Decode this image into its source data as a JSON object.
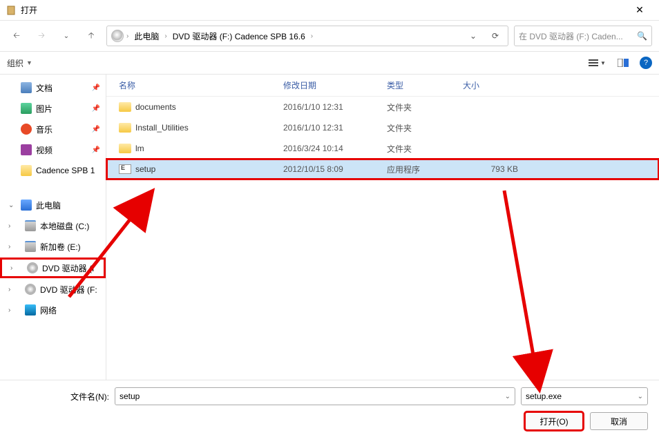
{
  "window": {
    "title": "打开"
  },
  "breadcrumb": {
    "root": "此电脑",
    "drive": "DVD 驱动器 (F:) Cadence SPB 16.6"
  },
  "search": {
    "placeholder": "在 DVD 驱动器 (F:) Caden..."
  },
  "toolbar": {
    "organize": "组织"
  },
  "sidebar": {
    "quick": [
      {
        "label": "文档",
        "icon": "qi-doc"
      },
      {
        "label": "图片",
        "icon": "qi-pic"
      },
      {
        "label": "音乐",
        "icon": "qi-music"
      },
      {
        "label": "视频",
        "icon": "qi-video"
      },
      {
        "label": "Cadence SPB 1",
        "icon": "qi-folder"
      }
    ],
    "thispc": {
      "label": "此电脑"
    },
    "drives": [
      {
        "label": "本地磁盘 (C:)",
        "icon": "qi-drive"
      },
      {
        "label": "新加卷 (E:)",
        "icon": "qi-drive"
      },
      {
        "label": "DVD 驱动器 (I",
        "icon": "qi-disc",
        "highlight": true
      },
      {
        "label": "DVD 驱动器 (F:",
        "icon": "qi-disc"
      },
      {
        "label": "网络",
        "icon": "qi-net"
      }
    ]
  },
  "columns": {
    "name": "名称",
    "date": "修改日期",
    "type": "类型",
    "size": "大小"
  },
  "files": [
    {
      "name": "documents",
      "date": "2016/1/10 12:31",
      "type": "文件夹",
      "size": "",
      "icon": "folder-icon"
    },
    {
      "name": "Install_Utilities",
      "date": "2016/1/10 12:31",
      "type": "文件夹",
      "size": "",
      "icon": "folder-icon"
    },
    {
      "name": "lm",
      "date": "2016/3/24 10:14",
      "type": "文件夹",
      "size": "",
      "icon": "folder-icon"
    },
    {
      "name": "setup",
      "date": "2012/10/15 8:09",
      "type": "应用程序",
      "size": "793 KB",
      "icon": "exe-icon",
      "selected": true
    }
  ],
  "footer": {
    "filename_label": "文件名(N):",
    "filename_value": "setup",
    "filter": "setup.exe",
    "open": "打开(O)",
    "cancel": "取消"
  }
}
